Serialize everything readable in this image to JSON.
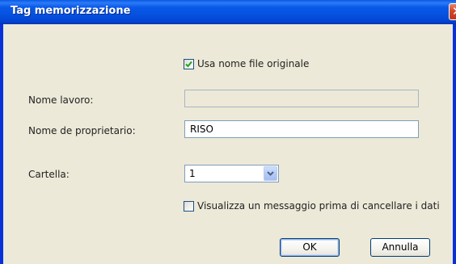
{
  "window": {
    "title": "Tag memorizzazione",
    "close_glyph": "✕"
  },
  "form": {
    "use_original_filename": {
      "label": "Usa nome file originale",
      "checked": true
    },
    "job_name": {
      "label": "Nome lavoro:",
      "value": "",
      "enabled": false
    },
    "owner_name": {
      "label": "Nome de proprietario:",
      "value": "RISO"
    },
    "folder": {
      "label": "Cartella:",
      "selected": "1"
    },
    "show_message_before_delete": {
      "label": "Visualizza un messaggio prima di cancellare i dati",
      "checked": false
    }
  },
  "buttons": {
    "ok_label": "OK",
    "cancel_label": "Annulla"
  },
  "colors": {
    "titlebar": "#0a58e8",
    "dialog_background": "#ece9d8",
    "close_button": "#d2472a"
  }
}
